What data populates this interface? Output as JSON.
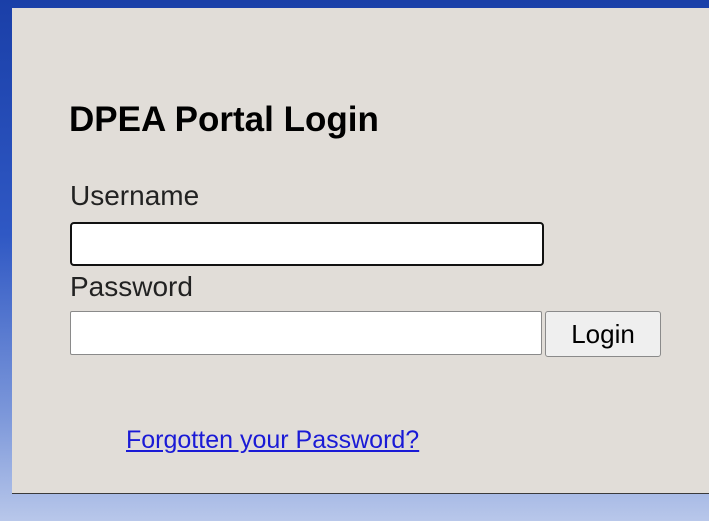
{
  "login": {
    "title": "DPEA Portal Login",
    "username_label": "Username",
    "username_value": "",
    "password_label": "Password",
    "password_value": "",
    "login_button_label": "Login",
    "forgot_link_text": "Forgotten your Password?"
  },
  "colors": {
    "panel_background": "#e1ddd8",
    "frame_accent": "#1a3fa8",
    "link": "#1a1ad6"
  }
}
